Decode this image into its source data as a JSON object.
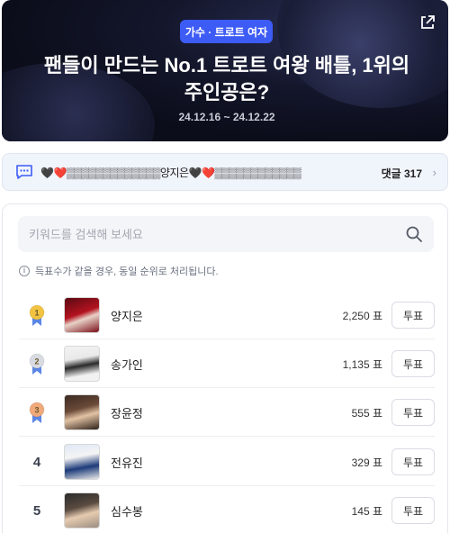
{
  "banner": {
    "tag": "가수 · 트로트 여자",
    "title_line1": "팬들이 만드는 No.1 트로트 여왕 배틀, 1위의",
    "title_line2": "주인공은?",
    "period": "24.12.16 ~ 24.12.22",
    "share_icon": "share-icon"
  },
  "comment_bar": {
    "text": "🖤❤️▒▒▒▒▒▒▒▒▒▒▒▒▒양지은🖤❤️▒▒▒▒▒▒▒▒▒▒▒▒",
    "count": "댓글 317",
    "chevron": "›"
  },
  "search": {
    "placeholder": "키워드를 검색해 보세요"
  },
  "notice": {
    "icon": "i",
    "text": "득표수가 같을 경우, 동일 순위로 처리됩니다."
  },
  "vote_button_label": "투표",
  "ranking": [
    {
      "rank": "1",
      "medal": "gold",
      "name": "양지은",
      "votes": "2,250 표"
    },
    {
      "rank": "2",
      "medal": "silver",
      "name": "송가인",
      "votes": "1,135 표"
    },
    {
      "rank": "3",
      "medal": "bronze",
      "name": "장윤정",
      "votes": "555 표"
    },
    {
      "rank": "4",
      "medal": "",
      "name": "전유진",
      "votes": "329 표"
    },
    {
      "rank": "5",
      "medal": "",
      "name": "심수봉",
      "votes": "145 표"
    }
  ],
  "colors": {
    "accent": "#3d5bf5",
    "gold": "#f2c341",
    "silver": "#d9dbe3",
    "bronze": "#f0a97a",
    "ribbon": "#5b86e5"
  }
}
